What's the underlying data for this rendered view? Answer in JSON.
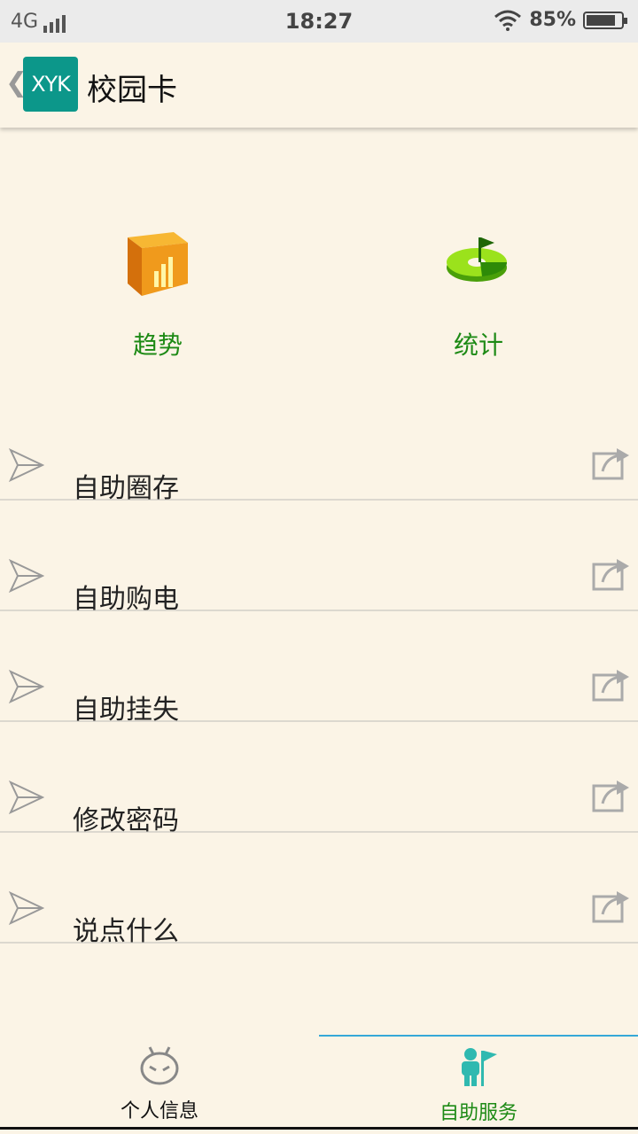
{
  "status_bar": {
    "network": "4G",
    "time": "18:27",
    "battery_percent_text": "85%",
    "battery_level": 0.85
  },
  "app_bar": {
    "logo_text": "XYK",
    "title": "校园卡"
  },
  "features": [
    {
      "label": "趋势",
      "icon": "trend-cube-icon"
    },
    {
      "label": "统计",
      "icon": "pie-chart-icon"
    }
  ],
  "menu": [
    {
      "label": "自助圈存"
    },
    {
      "label": "自助购电"
    },
    {
      "label": "自助挂失"
    },
    {
      "label": "修改密码"
    },
    {
      "label": "说点什么"
    }
  ],
  "bottom_nav": [
    {
      "label": "个人信息",
      "icon": "robot-face-icon",
      "active": false
    },
    {
      "label": "自助服务",
      "icon": "person-flag-icon",
      "active": true
    }
  ],
  "colors": {
    "background": "#fbf4e6",
    "accent_green": "#1d8a15",
    "logo_teal": "#0c978a",
    "active_tab_line": "#35a8d8"
  }
}
